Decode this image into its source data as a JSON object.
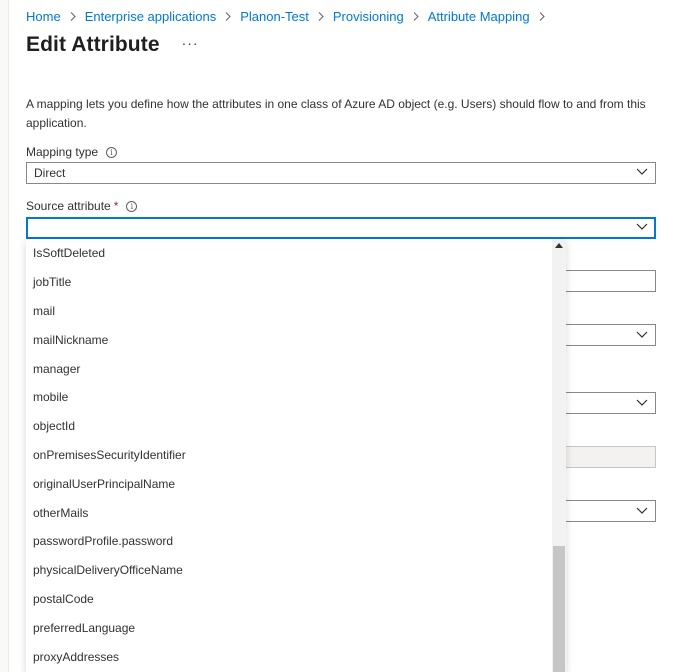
{
  "breadcrumb": [
    "Home",
    "Enterprise applications",
    "Planon-Test",
    "Provisioning",
    "Attribute Mapping"
  ],
  "page": {
    "title": "Edit Attribute",
    "more_label": "···",
    "description": "A mapping lets you define how the attributes in one class of Azure AD object (e.g. Users) should flow to and from this application."
  },
  "mapping_type": {
    "label": "Mapping type",
    "value": "Direct"
  },
  "source_attribute": {
    "label": "Source attribute",
    "required_mark": "*",
    "value": ""
  },
  "source_options": [
    "IsSoftDeleted",
    "jobTitle",
    "mail",
    "mailNickname",
    "manager",
    "mobile",
    "objectId",
    "onPremisesSecurityIdentifier",
    "originalUserPrincipalName",
    "otherMails",
    "passwordProfile.password",
    "physicalDeliveryOfficeName",
    "postalCode",
    "preferredLanguage",
    "proxyAddresses"
  ],
  "icons": {
    "info": "info-icon",
    "chevron": "chevron-down-icon",
    "separator": "chevron-right-icon"
  },
  "colors": {
    "link": "#0078d4",
    "focus": "#0078d4",
    "required": "#a4262c"
  }
}
